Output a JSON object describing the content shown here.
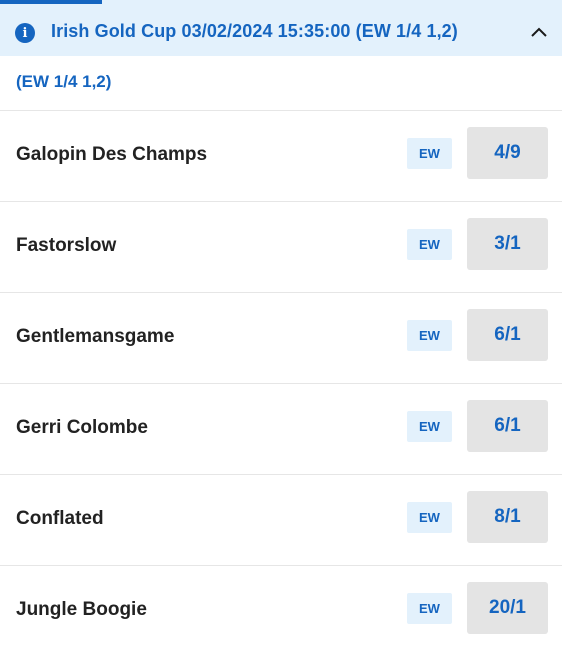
{
  "market": {
    "title": "Irish Gold Cup 03/02/2024 15:35:00 (EW 1/4 1,2)",
    "info_icon_glyph": "i",
    "each_way_terms": "(EW 1/4 1,2)",
    "accent_color": "#1565c0",
    "header_bg": "#e3f1fc"
  },
  "runners": [
    {
      "name": "Galopin Des Champs",
      "ew_label": "EW",
      "odds": "4/9"
    },
    {
      "name": "Fastorslow",
      "ew_label": "EW",
      "odds": "3/1"
    },
    {
      "name": "Gentlemansgame",
      "ew_label": "EW",
      "odds": "6/1"
    },
    {
      "name": "Gerri Colombe",
      "ew_label": "EW",
      "odds": "6/1"
    },
    {
      "name": "Conflated",
      "ew_label": "EW",
      "odds": "8/1"
    },
    {
      "name": "Jungle Boogie",
      "ew_label": "EW",
      "odds": "20/1"
    }
  ]
}
